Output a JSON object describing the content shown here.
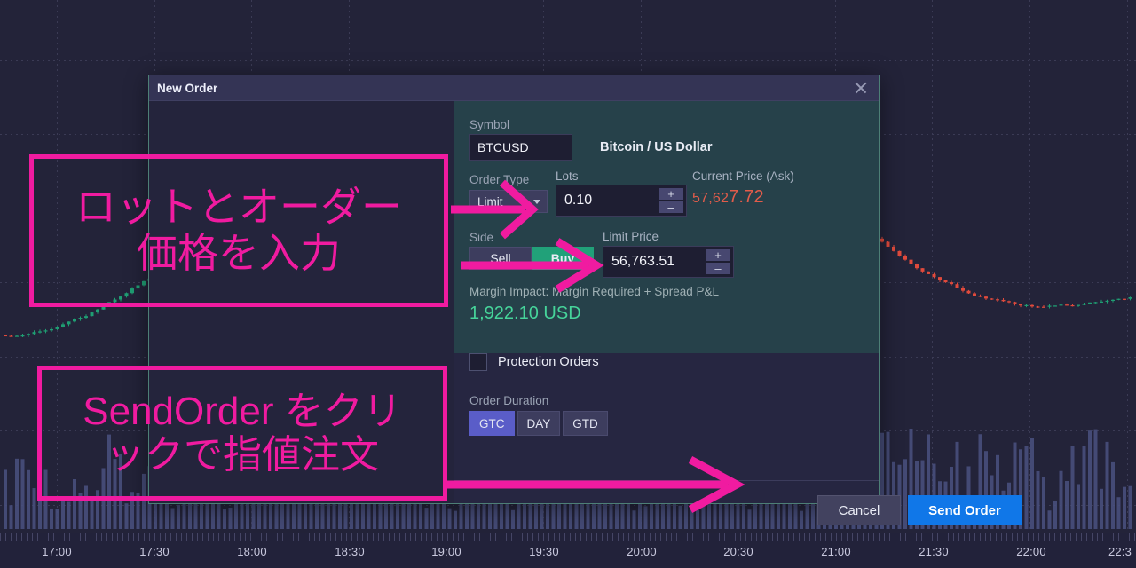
{
  "window": {
    "title": "New Order",
    "close_icon": "close-icon"
  },
  "form": {
    "symbol_label": "Symbol",
    "symbol_value": "BTCUSD",
    "symbol_description": "Bitcoin / US Dollar",
    "order_type_label": "Order Type",
    "order_type_value": "Limit",
    "lots_label": "Lots",
    "lots_value": "0.10",
    "current_price_label": "Current Price (Ask)",
    "current_price_value": "57,627.72",
    "current_price_head": "57,62",
    "current_price_tail": "7.72",
    "side_label": "Side",
    "side_sell": "Sell",
    "side_buy": "Buy",
    "side_selected": "Buy",
    "limit_price_label": "Limit Price",
    "limit_price_value": "56,763.51",
    "margin_label": "Margin Impact: Margin Required + Spread P&L",
    "margin_value": "1,922.10 USD",
    "protection_orders_label": "Protection Orders",
    "protection_orders_checked": false,
    "order_duration_label": "Order Duration",
    "duration_options": [
      "GTC",
      "DAY",
      "GTD"
    ],
    "duration_selected": "GTC",
    "spinner_plus": "+",
    "spinner_minus": "–"
  },
  "footer": {
    "cancel_label": "Cancel",
    "send_label": "Send Order"
  },
  "annotations": [
    {
      "id": "anno1",
      "line1": "ロットとオーダー",
      "line2": "価格を入力"
    },
    {
      "id": "anno2",
      "line1": "SendOrder をクリ",
      "line2": "ックで指値注文"
    }
  ],
  "chart_data": {
    "type": "candlestick",
    "title": "",
    "xlabel": "",
    "ylabel": "",
    "grid": true,
    "time_axis_labels": [
      "17:00",
      "17:30",
      "18:00",
      "18:30",
      "19:00",
      "19:30",
      "20:00",
      "20:30",
      "21:00",
      "21:30",
      "22:00",
      "22:3"
    ],
    "time_axis_x": [
      64,
      174,
      284,
      394,
      503,
      613,
      723,
      832,
      942,
      1052,
      1162,
      1262
    ],
    "up_color": "#1f9e73",
    "down_color": "#e04a3c",
    "volume_color": "#4a5180",
    "overlay_line_green": "#2fa37c",
    "overlay_line_orange": "#d5714a",
    "background": "#232339"
  },
  "colors": {
    "accent_magenta": "#f01ba0",
    "send_blue": "#1077e8",
    "buy_green": "#21a179",
    "duration_active": "#5a5dc8",
    "price_red": "#e25c4a",
    "margin_green": "#46d49a",
    "teal_panel": "#26414a",
    "dialog_bg": "#262641",
    "titlebar_bg": "#343455"
  }
}
